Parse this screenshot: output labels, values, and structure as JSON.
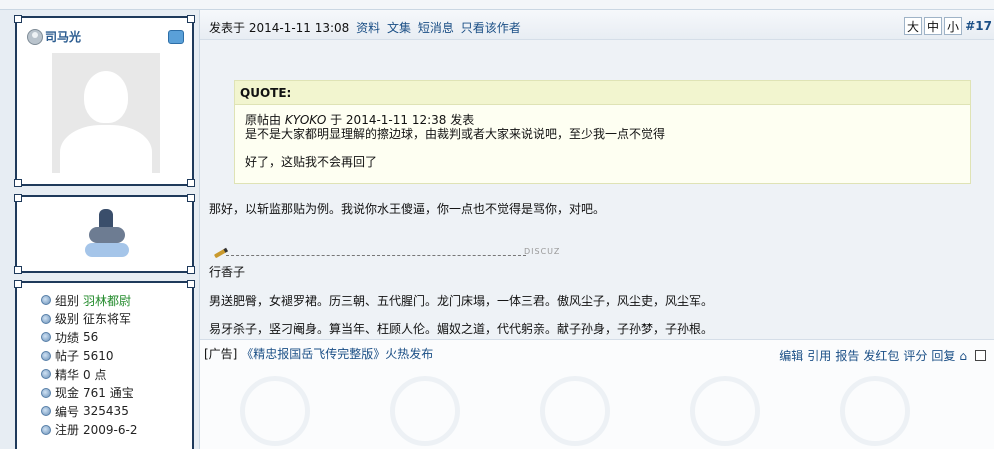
{
  "user": {
    "name": "司马光",
    "profile": [
      {
        "label": "组别",
        "value": "羽林都尉",
        "highlight": true
      },
      {
        "label": "级别",
        "value": "征东将军",
        "highlight": false
      },
      {
        "label": "功绩",
        "value": "56",
        "highlight": false
      },
      {
        "label": "帖子",
        "value": "5610",
        "highlight": false
      },
      {
        "label": "精华",
        "value": "0 点",
        "highlight": false
      },
      {
        "label": "现金",
        "value": "761 通宝",
        "highlight": false
      },
      {
        "label": "编号",
        "value": "325435",
        "highlight": false
      },
      {
        "label": "注册",
        "value": "2009-6-2",
        "highlight": false
      }
    ]
  },
  "post": {
    "posted_prefix": "发表于 2014-1-11 13:08",
    "links": [
      "资料",
      "文集",
      "短消息",
      "只看该作者"
    ],
    "font_sizes": [
      "大",
      "中",
      "小"
    ],
    "floor": "#17",
    "quote": {
      "title": "QUOTE:",
      "original_prefix": "原帖由",
      "original_author": "KYOKO",
      "original_suffix": "于 2014-1-11 12:38 发表",
      "line1": "是不是大家都明显理解的擦边球，由裁判或者大家来说说吧，至少我一点不觉得",
      "line2": "好了，这贴我不会再回了"
    },
    "body": "那好，以斩监那贴为例。我说你水王傻逼，你一点也不觉得是骂你，对吧。",
    "signature": {
      "tag": "DISCUZ",
      "name": "行香子",
      "p1": "男送肥臀，女褪罗裙。历三朝、五代腥门。龙门床塌，一体三君。傲风尘子，风尘吏，风尘军。",
      "p2": "易牙杀子，竖刁阉身。算当年、枉顾人伦。媚奴之道，代代躬亲。献子孙身，子孙梦，子孙根。"
    },
    "ad_prefix": "[广告]",
    "ad_link": "《精忠报国岳飞传完整版》火热发布",
    "actions": [
      "编辑",
      "引用",
      "报告",
      "发红包",
      "评分",
      "回复"
    ]
  },
  "colors": {
    "link": "#1b4f86",
    "highlight": "#218a2a",
    "border": "#1f3a5b"
  }
}
